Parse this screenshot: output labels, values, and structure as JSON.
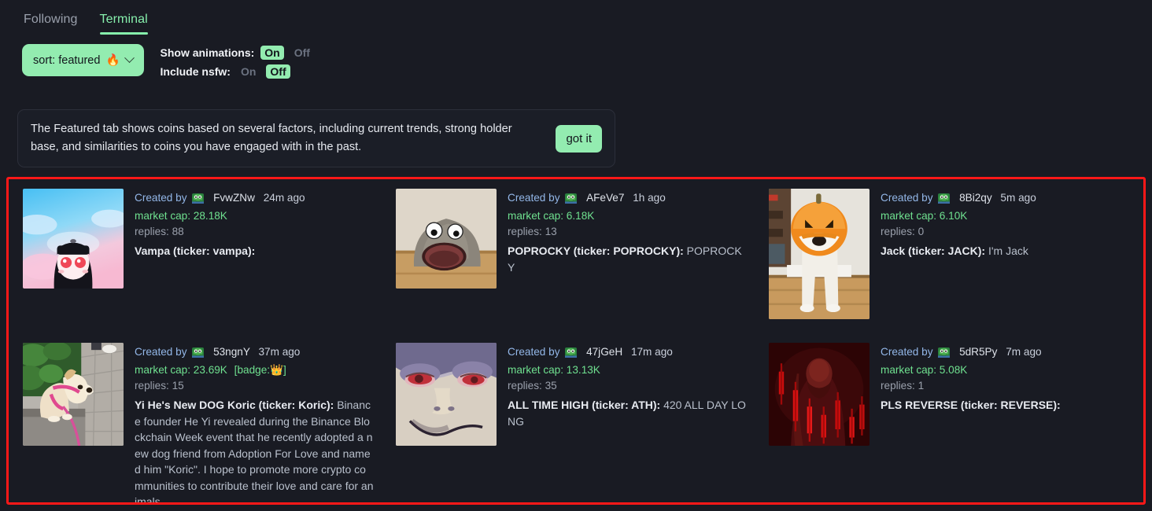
{
  "theme": {
    "background": "#191b23",
    "accent_green": "#93ecb0",
    "market_cap_green": "#6fe08f",
    "highlight_border": "#ff1818",
    "created_by_blue": "#93b7e8"
  },
  "tabs": [
    {
      "label": "Following",
      "active": false
    },
    {
      "label": "Terminal",
      "active": true
    }
  ],
  "controls": {
    "sort_label": "sort: featured",
    "sort_emoji": "🔥",
    "chevron_icon": "chevron-down-icon",
    "show_animations": {
      "label": "Show animations:",
      "on_label": "On",
      "off_label": "Off",
      "selected": "On"
    },
    "include_nsfw": {
      "label": "Include nsfw:",
      "on_label": "On",
      "off_label": "Off",
      "selected": "Off"
    }
  },
  "banner": {
    "text": "The Featured tab shows coins based on several factors, including current trends, strong holder base, and similarities to coins you have engaged with in the past.",
    "button_label": "got it"
  },
  "feed": {
    "created_by_prefix": "Created by",
    "avatar_icon": "pepe-avatar-icon",
    "cards": [
      {
        "id": "vampa",
        "creator": "FvwZNw",
        "age": "24m ago",
        "market_cap": "market cap: 28.18K",
        "badge": "",
        "replies": "replies: 88",
        "title": "Vampa (ticker: vampa):",
        "description": "",
        "thumb_name": "vampa-thumbnail"
      },
      {
        "id": "poprocky",
        "creator": "AFeVe7",
        "age": "1h ago",
        "market_cap": "market cap: 6.18K",
        "badge": "",
        "replies": "replies: 13",
        "title": "POPROCKY (ticker: POPROCKY):",
        "description": " POPROCKY",
        "thumb_name": "poprocky-thumbnail"
      },
      {
        "id": "jack",
        "creator": "8Bi2qy",
        "age": "5m ago",
        "market_cap": "market cap: 6.10K",
        "badge": "",
        "replies": "replies: 0",
        "title": "Jack (ticker: JACK):",
        "description": " I'm Jack",
        "thumb_name": "jack-thumbnail"
      },
      {
        "id": "koric",
        "creator": "53ngnY",
        "age": "37m ago",
        "market_cap": "market cap: 23.69K",
        "badge": "[badge:👑]",
        "replies": "replies: 15",
        "title": "Yi He's New DOG Koric (ticker: Koric):",
        "description": " Binance founder He Yi revealed during the Binance Blockchain Week event that he recently adopted a new dog friend from Adoption For Love and named him \"Koric\". I hope to promote more crypto communities to contribute their love and care for animals.",
        "thumb_name": "koric-thumbnail"
      },
      {
        "id": "ath",
        "creator": "47jGeH",
        "age": "17m ago",
        "market_cap": "market cap: 13.13K",
        "badge": "",
        "replies": "replies: 35",
        "title": "ALL TIME HIGH (ticker: ATH):",
        "description": " 420 ALL DAY LONG",
        "thumb_name": "ath-thumbnail"
      },
      {
        "id": "reverse",
        "creator": "5dR5Py",
        "age": "7m ago",
        "market_cap": "market cap: 5.08K",
        "badge": "",
        "replies": "replies: 1",
        "title": "PLS REVERSE (ticker: REVERSE):",
        "description": "",
        "thumb_name": "reverse-thumbnail"
      }
    ]
  }
}
